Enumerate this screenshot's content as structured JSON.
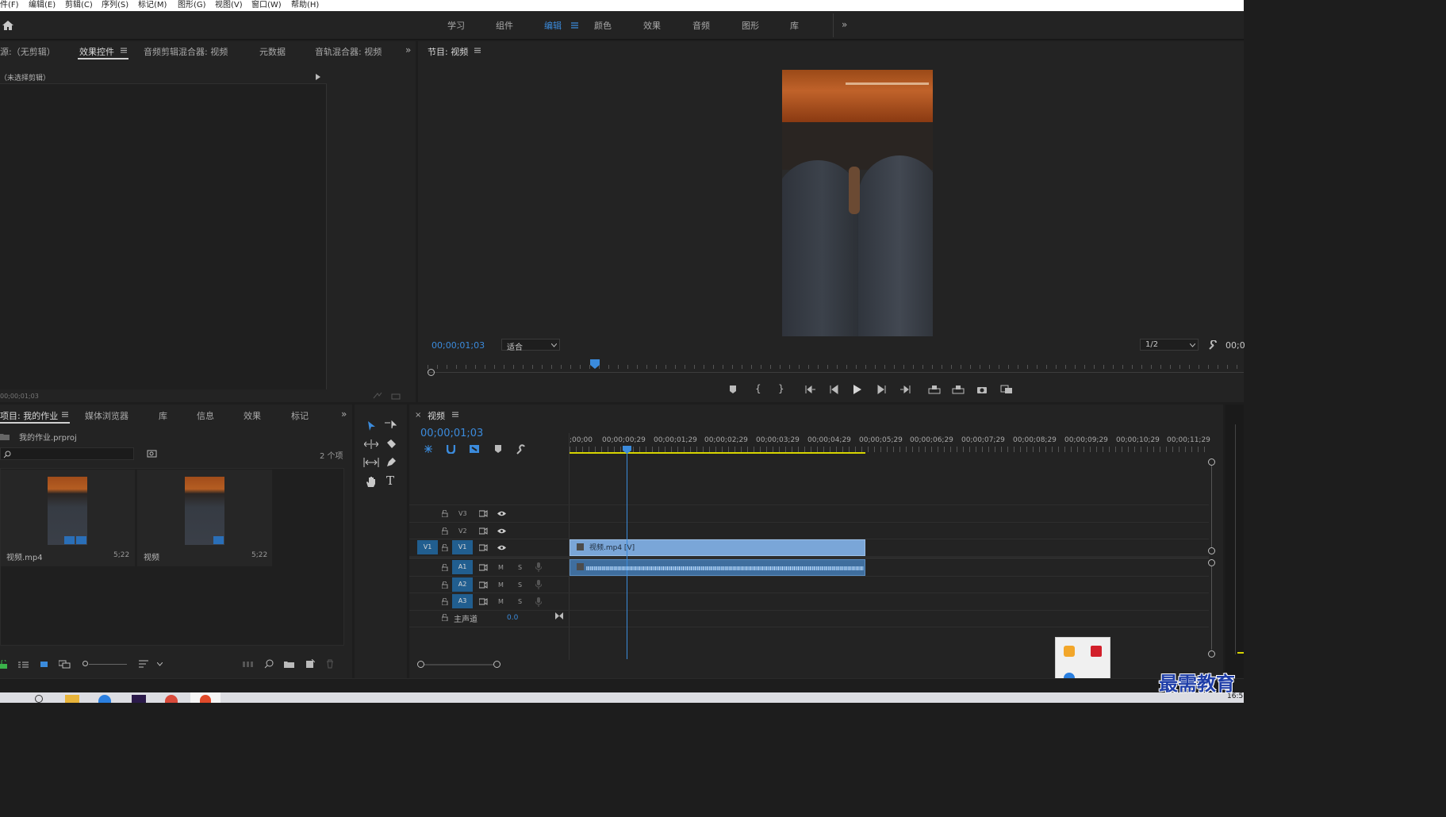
{
  "menu": [
    "件(F)",
    "编辑(E)",
    "剪辑(C)",
    "序列(S)",
    "标记(M)",
    "图形(G)",
    "视图(V)",
    "窗口(W)",
    "帮助(H)"
  ],
  "workspaces": [
    "学习",
    "组件",
    "编辑",
    "颜色",
    "效果",
    "音频",
    "图形",
    "库"
  ],
  "active_workspace": "编辑",
  "source_panel": {
    "tabs": [
      "源:（无剪辑）",
      "效果控件",
      "音频剪辑混合器: 视频",
      "元数据",
      "音轨混合器: 视频"
    ],
    "active_tab": "效果控件",
    "no_clip_label": "（未选择剪辑）",
    "timecode": "00;00;01;03"
  },
  "program_monitor": {
    "title": "节目: 视频",
    "timecode": "00;00;01;03",
    "fit": "适合",
    "resolution": "1/2",
    "right_timecode": "00;0"
  },
  "project_panel": {
    "tabs": [
      "项目: 我的作业",
      "媒体浏览器",
      "库",
      "信息",
      "效果",
      "标记"
    ],
    "active_tab": "项目: 我的作业",
    "file": "我的作业.prproj",
    "search_placeholder": "",
    "count": "2 个项",
    "items": [
      {
        "name": "视频.mp4",
        "duration": "5;22"
      },
      {
        "name": "视频",
        "duration": "5;22"
      }
    ]
  },
  "timeline": {
    "tab": "视频",
    "timecode": "00;00;01;03",
    "ruler": [
      ";00;00",
      "00;00;00;29",
      "00;00;01;29",
      "00;00;02;29",
      "00;00;03;29",
      "00;00;04;29",
      "00;00;05;29",
      "00;00;06;29",
      "00;00;07;29",
      "00;00;08;29",
      "00;00;09;29",
      "00;00;10;29",
      "00;00;11;29"
    ],
    "video_tracks": [
      "V3",
      "V2",
      "V1"
    ],
    "audio_tracks": [
      "A1",
      "A2",
      "A3"
    ],
    "source_patch_video": "V1",
    "master_label": "主声道",
    "master_value": "0.0",
    "track_mute": "M",
    "track_solo": "S",
    "video_clip": "视频.mp4 [V]"
  },
  "watermark": "最需教育",
  "clock": "16:5",
  "colors": {
    "accent": "#3b8bdc",
    "clip_video": "#7aa6d8",
    "clip_audio": "#3f6e9e",
    "work_area": "#d7d400"
  }
}
